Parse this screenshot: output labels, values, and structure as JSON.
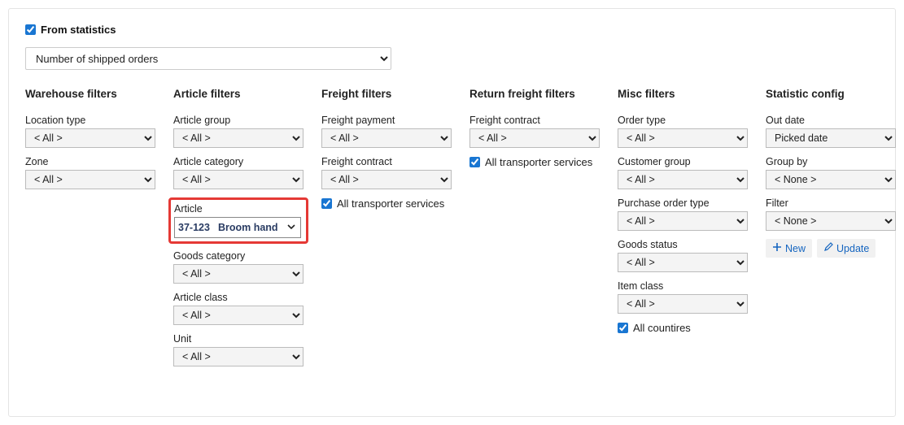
{
  "top": {
    "from_stats_label": "From statistics",
    "from_stats_checked": true,
    "statistic": "Number of shipped orders"
  },
  "warehouse": {
    "title": "Warehouse filters",
    "location_type": {
      "label": "Location type",
      "value": "< All >"
    },
    "zone": {
      "label": "Zone",
      "value": "< All >"
    }
  },
  "article": {
    "title": "Article filters",
    "group": {
      "label": "Article group",
      "value": "< All >"
    },
    "category": {
      "label": "Article category",
      "value": "< All >"
    },
    "article": {
      "label": "Article",
      "code": "37-123",
      "name": "Broom hand"
    },
    "goods_category": {
      "label": "Goods category",
      "value": "< All >"
    },
    "article_class": {
      "label": "Article class",
      "value": "< All >"
    },
    "unit": {
      "label": "Unit",
      "value": "< All >"
    }
  },
  "freight": {
    "title": "Freight filters",
    "payment": {
      "label": "Freight payment",
      "value": "< All >"
    },
    "contract": {
      "label": "Freight contract",
      "value": "< All >"
    },
    "all_transporter_label": "All transporter services",
    "all_transporter_checked": true
  },
  "return_freight": {
    "title": "Return freight filters",
    "contract": {
      "label": "Freight contract",
      "value": "< All >"
    },
    "all_transporter_label": "All transporter services",
    "all_transporter_checked": true
  },
  "misc": {
    "title": "Misc filters",
    "order_type": {
      "label": "Order type",
      "value": "< All >"
    },
    "customer_group": {
      "label": "Customer group",
      "value": "< All >"
    },
    "po_type": {
      "label": "Purchase order type",
      "value": "< All >"
    },
    "goods_status": {
      "label": "Goods status",
      "value": "< All >"
    },
    "item_class": {
      "label": "Item class",
      "value": "< All >"
    },
    "all_countries_label": "All countires",
    "all_countries_checked": true
  },
  "config": {
    "title": "Statistic config",
    "out_date": {
      "label": "Out date",
      "value": "Picked date"
    },
    "group_by": {
      "label": "Group by",
      "value": "< None >"
    },
    "filter": {
      "label": "Filter",
      "value": "< None >"
    },
    "new_label": "New",
    "update_label": "Update"
  }
}
